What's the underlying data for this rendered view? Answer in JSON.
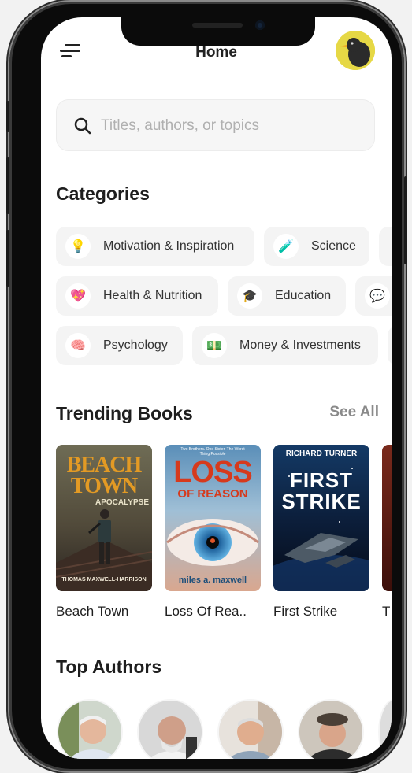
{
  "header": {
    "title": "Home"
  },
  "search": {
    "placeholder": "Titles, authors, or topics"
  },
  "categories": {
    "heading": "Categories",
    "items": [
      {
        "label": "Motivation & Inspiration",
        "icon": "lightbulb-icon"
      },
      {
        "label": "Science",
        "icon": "flask-icon"
      },
      {
        "label": "Health & Nutrition",
        "icon": "heart-icon"
      },
      {
        "label": "Education",
        "icon": "graduation-cap-icon"
      },
      {
        "label": "Psychology",
        "icon": "brain-icon"
      },
      {
        "label": "Money & Investments",
        "icon": "money-icon"
      }
    ]
  },
  "trending": {
    "heading": "Trending Books",
    "see_all": "See All",
    "books": [
      {
        "title": "Beach Town",
        "cover_title": "BEACH TOWN",
        "cover_subtitle": "APOCALYPSE",
        "cover_author": "THOMAS MAXWELL-HARRISON"
      },
      {
        "title": "Loss Of Rea..",
        "cover_title": "LOSS",
        "cover_subtitle": "OF REASON",
        "cover_author": "miles a. maxwell",
        "cover_tagline": "Two Brothers. One Sister. The Worst Thing Possible"
      },
      {
        "title": "First Strike",
        "cover_title": "FIRST STRIKE",
        "cover_author": "RICHARD TURNER"
      },
      {
        "title": "T"
      }
    ]
  },
  "authors": {
    "heading": "Top Authors"
  }
}
